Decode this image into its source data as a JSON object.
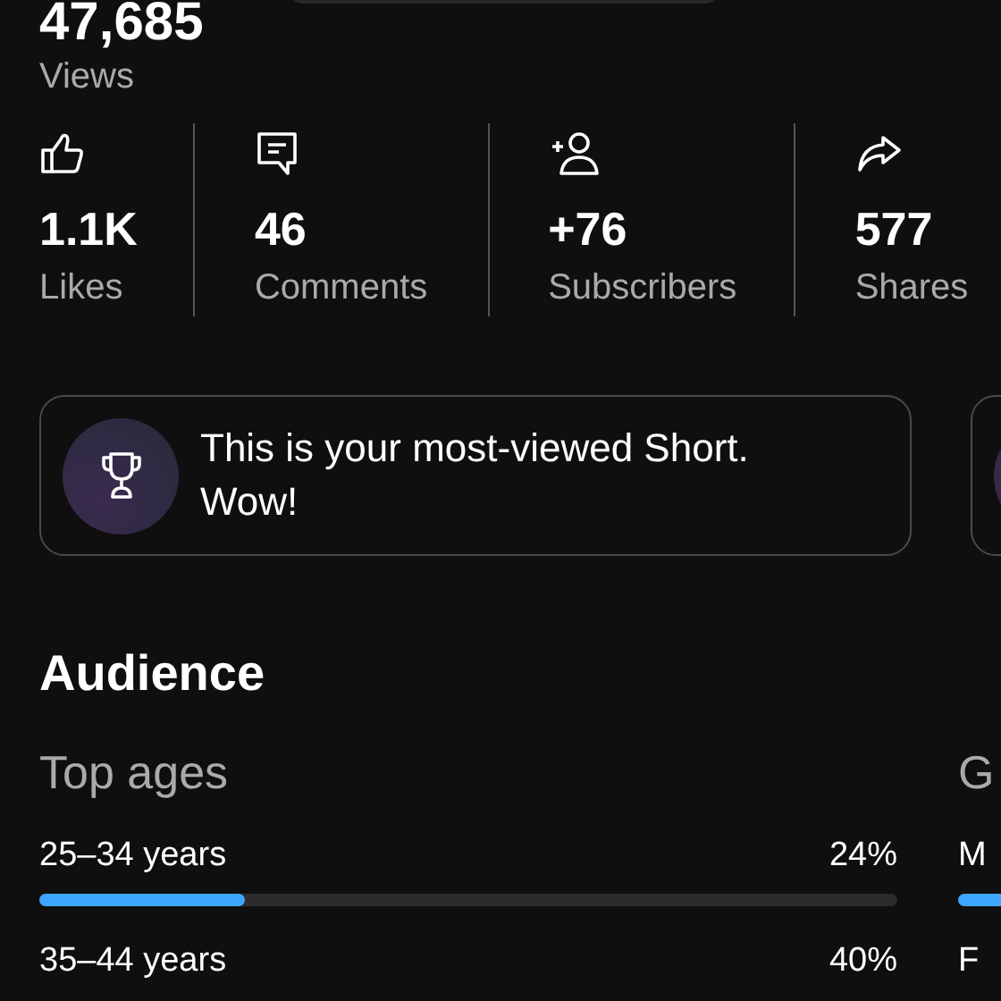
{
  "views": {
    "value": "47,685",
    "label": "Views"
  },
  "stats": [
    {
      "kind": "likes",
      "value": "1.1K",
      "label": "Likes"
    },
    {
      "kind": "comments",
      "value": "46",
      "label": "Comments"
    },
    {
      "kind": "subscribers",
      "value": "+76",
      "label": "Subscribers"
    },
    {
      "kind": "shares",
      "value": "577",
      "label": "Shares"
    }
  ],
  "highlight_cards": [
    {
      "kind": "trophy",
      "text": "This is your most-viewed Short. Wow!"
    },
    {
      "kind": "partial"
    }
  ],
  "audience": {
    "title": "Audience",
    "sections": [
      {
        "title": "Top ages",
        "rows": [
          {
            "label": "25–34 years",
            "value": "24%",
            "kind": "bar",
            "level": 0.24
          },
          {
            "label": "35–44 years",
            "value": "40%"
          }
        ]
      },
      {
        "title": "G",
        "rows": [
          {
            "label": "M",
            "kind": "bar"
          },
          {
            "label": "F"
          }
        ]
      }
    ]
  }
}
